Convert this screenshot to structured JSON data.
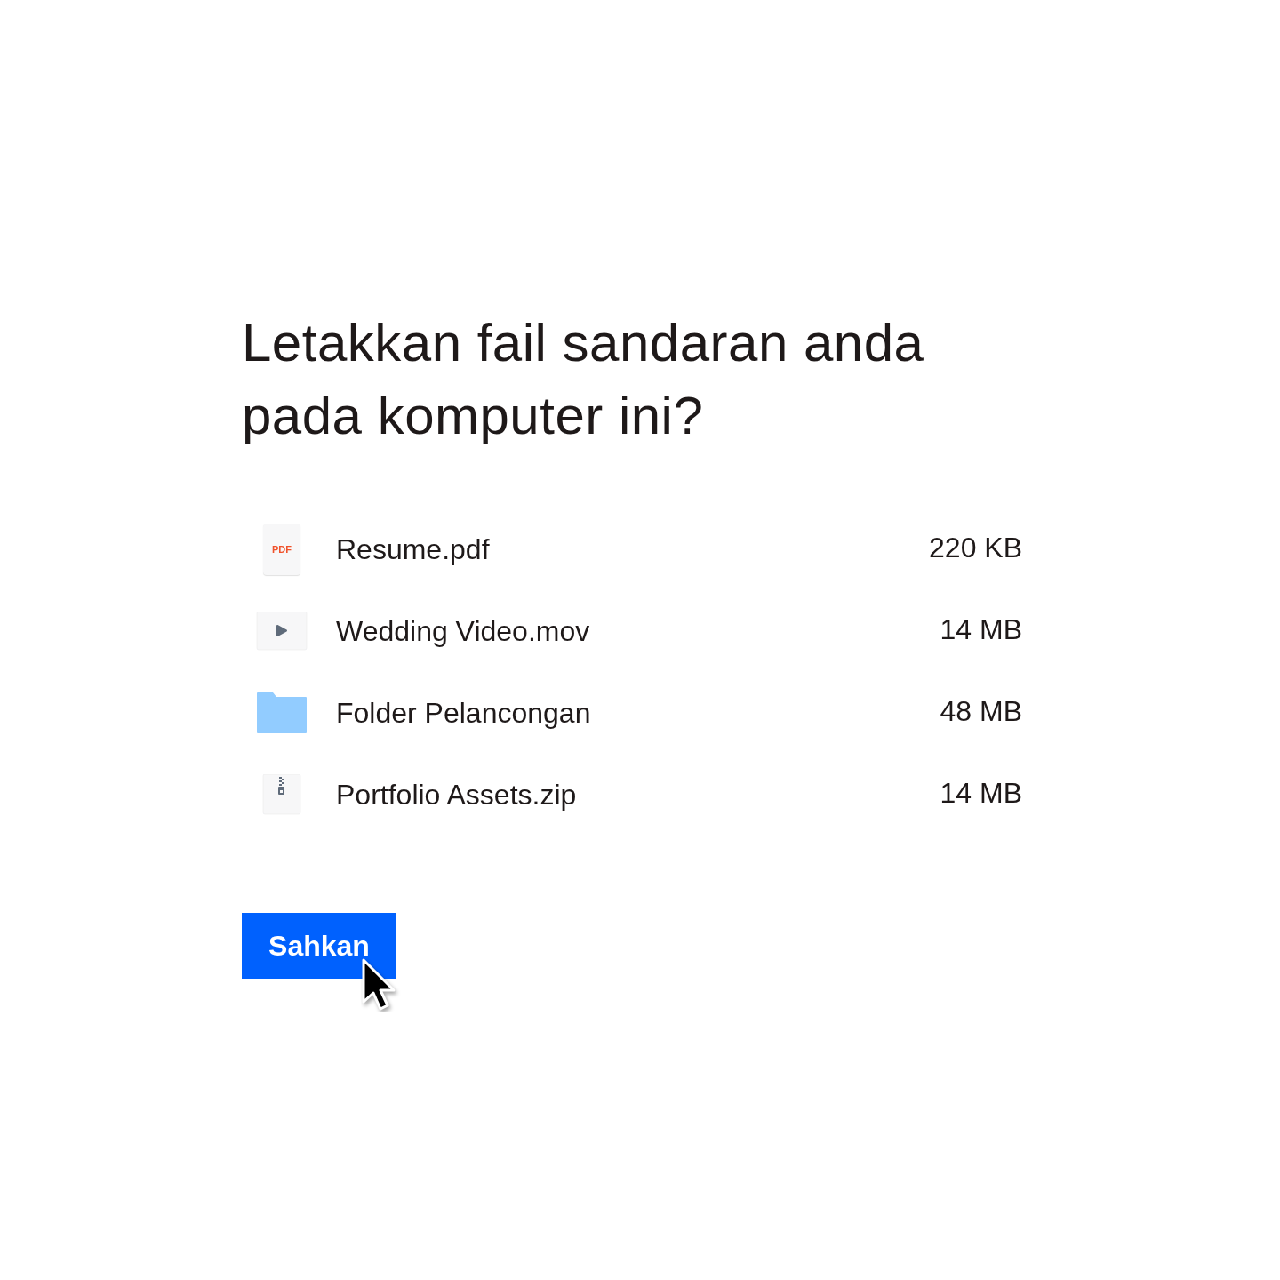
{
  "heading": "Letakkan fail sandaran anda pada komputer ini?",
  "files": [
    {
      "kind": "pdf",
      "badge": "PDF",
      "name": "Resume.pdf",
      "size": "220 KB"
    },
    {
      "kind": "video",
      "name": "Wedding Video.mov",
      "size": "14 MB"
    },
    {
      "kind": "folder",
      "name": "Folder Pelancongan",
      "size": "48 MB"
    },
    {
      "kind": "zip",
      "name": "Portfolio Assets.zip",
      "size": "14 MB"
    }
  ],
  "button": "Sahkan"
}
